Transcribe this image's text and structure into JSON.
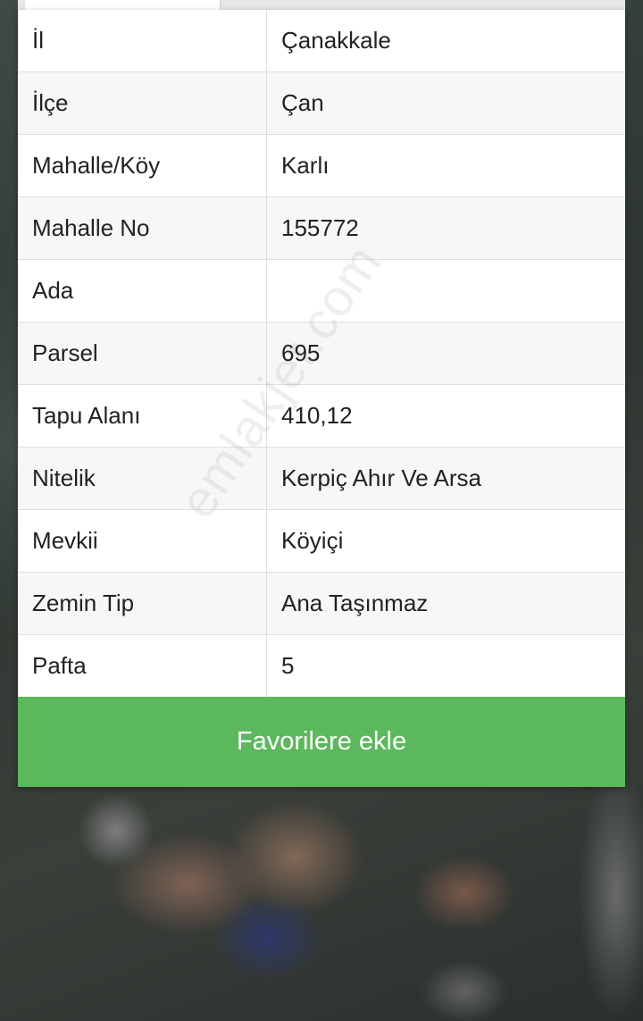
{
  "rows": [
    {
      "label": "İl",
      "value": "Çanakkale"
    },
    {
      "label": "İlçe",
      "value": "Çan"
    },
    {
      "label": "Mahalle/Köy",
      "value": "Karlı"
    },
    {
      "label": "Mahalle No",
      "value": "155772"
    },
    {
      "label": "Ada",
      "value": ""
    },
    {
      "label": "Parsel",
      "value": "695"
    },
    {
      "label": "Tapu Alanı",
      "value": "410,12"
    },
    {
      "label": "Nitelik",
      "value": "Kerpiç Ahır Ve Arsa"
    },
    {
      "label": "Mevkii",
      "value": "Köyiçi"
    },
    {
      "label": "Zemin Tip",
      "value": "Ana Taşınmaz"
    },
    {
      "label": "Pafta",
      "value": "5"
    }
  ],
  "favorite_button_label": "Favorilere ekle",
  "watermark_text": "emlakjet.com",
  "colors": {
    "button_green": "#5cb85c",
    "row_alt": "#f7f7f7"
  }
}
